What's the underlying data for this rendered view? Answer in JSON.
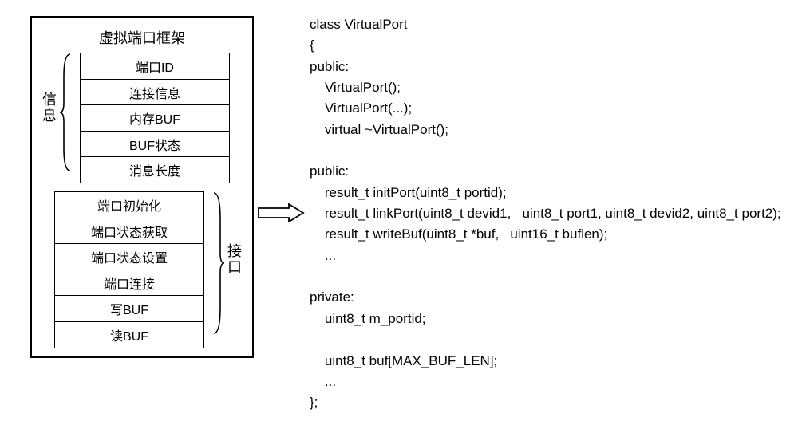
{
  "diagram": {
    "frame_title": "虚拟端口框架",
    "group1_label": "信\n息",
    "group1_rows": [
      "端口ID",
      "连接信息",
      "内存BUF",
      "BUF状态",
      "消息长度"
    ],
    "group2_label": "接\n口",
    "group2_rows": [
      "端口初始化",
      "端口状态获取",
      "端口状态设置",
      "端口连接",
      "写BUF",
      "读BUF"
    ]
  },
  "code": {
    "l0": "class VirtualPort",
    "l1": "{",
    "l2": "public:",
    "l3": "    VirtualPort();",
    "l4": "    VirtualPort(...);",
    "l5": "    virtual ~VirtualPort();",
    "l6": "",
    "l7": "public:",
    "l8": "    result_t initPort(uint8_t portid);",
    "l9": "    result_t linkPort(uint8_t devid1,   uint8_t port1, uint8_t devid2, uint8_t port2);",
    "l10": "    result_t writeBuf(uint8_t *buf,   uint16_t buflen);",
    "l11": "    ...",
    "l12": "",
    "l13": "private:",
    "l14": "    uint8_t m_portid;",
    "l15": "",
    "l16": "    uint8_t buf[MAX_BUF_LEN];",
    "l17": "    ...",
    "l18": "};"
  }
}
